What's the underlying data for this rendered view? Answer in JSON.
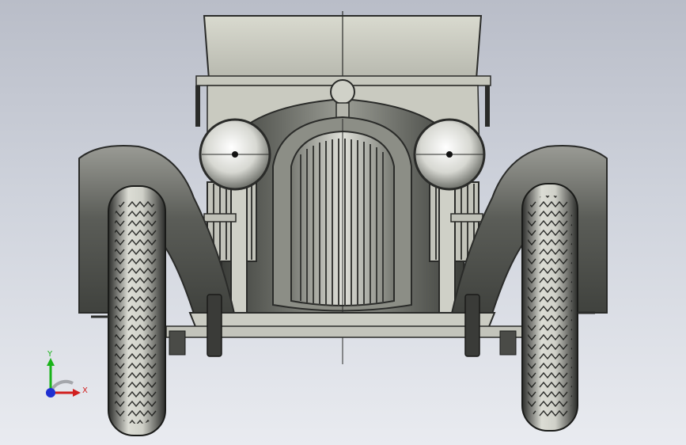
{
  "viewport": {
    "name": "3d-model-viewport",
    "model": "vintage-car-front-view"
  },
  "triad": {
    "x_label": "X",
    "y_label": "Y",
    "x_color": "#d11f1f",
    "y_color": "#19b319",
    "z_color": "#1f2fd1"
  },
  "colors": {
    "body": "#cfd0c6",
    "body_dark": "#6f716a",
    "fender": "#5d5f5a",
    "tire": "#2c2d2b",
    "tire_light": "#d8d9d2"
  }
}
